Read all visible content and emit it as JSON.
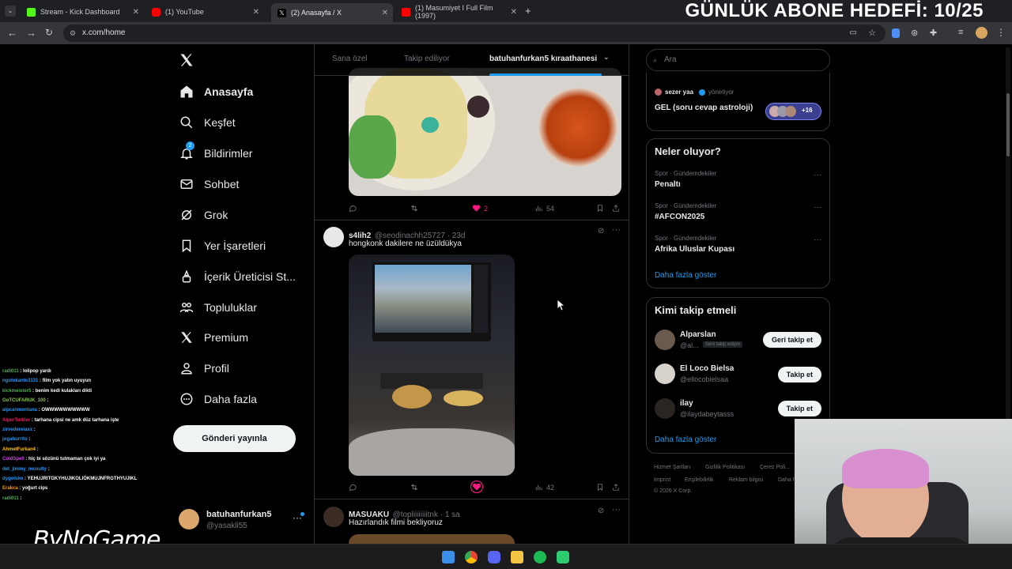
{
  "browser": {
    "tabs": [
      {
        "title": "Stream - Kick Dashboard",
        "color": "#53fc18"
      },
      {
        "title": "(1) YouTube",
        "color": "#ff0000"
      },
      {
        "title": "(2) Anasayfa / X",
        "color": "#ffffff",
        "active": true
      },
      {
        "title": "(1) Masumiyet I Full Film (1997)",
        "color": "#ff0000"
      }
    ],
    "url": "x.com/home",
    "new_tab": "+"
  },
  "overlay": {
    "goal_text": "GÜNLÜK ABONE HEDEFİ: 10/25",
    "brand_logo": "ByNoGame"
  },
  "nav": {
    "items": [
      {
        "label": "Anasayfa",
        "icon": "home-icon"
      },
      {
        "label": "Keşfet",
        "icon": "search-icon"
      },
      {
        "label": "Bildirimler",
        "icon": "bell-icon",
        "badge": "2"
      },
      {
        "label": "Sohbet",
        "icon": "mail-icon"
      },
      {
        "label": "Grok",
        "icon": "grok-icon"
      },
      {
        "label": "Yer İşaretleri",
        "icon": "bookmark-icon"
      },
      {
        "label": "İçerik Üreticisi St...",
        "icon": "creator-icon"
      },
      {
        "label": "Topluluklar",
        "icon": "communities-icon"
      },
      {
        "label": "Premium",
        "icon": "x-icon"
      },
      {
        "label": "Profil",
        "icon": "profile-icon"
      },
      {
        "label": "Daha fazla",
        "icon": "more-icon"
      }
    ],
    "post_button": "Gönderi yayınla",
    "account": {
      "name": "batuhanfurkan5",
      "handle": "@yasakli55"
    }
  },
  "feed": {
    "tabs": [
      "Sana özel",
      "Takip ediliyor",
      "batuhanfurkan5 kıraathanesi"
    ],
    "tweet1": {
      "likes": "2",
      "views": "54"
    },
    "tweet2": {
      "name": "s4lih2",
      "handle": "@seodinachh25727 · 23d",
      "text": "hongkonk dakilere ne üzüldükya",
      "views": "42"
    },
    "tweet3": {
      "name": "MASUAKU",
      "handle": "@topliiiiiiiitnk · 1 sa",
      "text": "Hazırlandık filmi bekliyoruz"
    }
  },
  "right": {
    "search_placeholder": "Ara",
    "space": {
      "host": "sezer yaa",
      "host_role": "yönetiyor",
      "title": "GEL (soru cevap astroloji)",
      "count": "+16"
    },
    "trends_header": "Neler oluyor?",
    "trends": [
      {
        "category": "Spor · Gündemdekiler",
        "name": "Penaltı"
      },
      {
        "category": "Spor · Gündemdekiler",
        "name": "#AFCON2025"
      },
      {
        "category": "Spor · Gündemdekiler",
        "name": "Afrika Uluslar Kupası"
      }
    ],
    "show_more": "Daha fazla göster",
    "who_header": "Kimi takip etmeli",
    "who": [
      {
        "name": "Alparslan",
        "handle": "@al...",
        "tag": "Seni takip ediyor",
        "button": "Geri takip et"
      },
      {
        "name": "El Loco Bielsa",
        "handle": "@ellocobielsaa",
        "button": "Takip et"
      },
      {
        "name": "ilay",
        "handle": "@ilaydabeytasss",
        "button": "Takip et"
      }
    ],
    "footer": [
      "Hizmet Şartları",
      "Gizlilik Politikası",
      "Çerez Poli...",
      "Imprint",
      "Erişilebilirlik",
      "Reklam bilgisi",
      "Daha f...",
      "© 2026 X Corp."
    ]
  },
  "chat": [
    {
      "user": "radi011",
      "msg": ": lolipop yardı",
      "color": "#4caf50"
    },
    {
      "user": "ngolokante3131",
      "msg": ": film yok yatın uyuyun",
      "color": "#2196f3"
    },
    {
      "user": "kickmeister5",
      "msg": ": benim kedi kulakları dikti",
      "color": "#4caf50"
    },
    {
      "user": "GoTCUFARUK_100",
      "msg": ":",
      "color": "#8bc34a"
    },
    {
      "user": "alpcanmontana",
      "msg": ": OWWWWWWWWWW",
      "color": "#2196f3"
    },
    {
      "user": "AlperTurkler",
      "msg": ": tarhana cipsi ne amk düz tarhana işte",
      "color": "#e91e63"
    },
    {
      "user": "zirvedereiaxx",
      "msg": ":",
      "color": "#2196f3"
    },
    {
      "user": "jogaburrito",
      "msg": ":",
      "color": "#2196f3"
    },
    {
      "user": "AhmetFurkan4",
      "msg": ":",
      "color": "#ffc107"
    },
    {
      "user": "ColdSpell",
      "msg": ": hiç bi sözünü tutmaman çok iyi ya",
      "color": "#e040fb"
    },
    {
      "user": "det_jimmy_mcnulty",
      "msg": ":",
      "color": "#2196f3"
    },
    {
      "user": "dygolskn",
      "msg": ": YEHUJRITGKYHUJIKOLIÖKMUJNFRGTHYUJIKL",
      "color": "#2196f3"
    },
    {
      "user": "Erakca",
      "msg": ": yoğurt cips",
      "color": "#ff9800"
    },
    {
      "user": "radi011",
      "msg": ":",
      "color": "#4caf50"
    }
  ]
}
